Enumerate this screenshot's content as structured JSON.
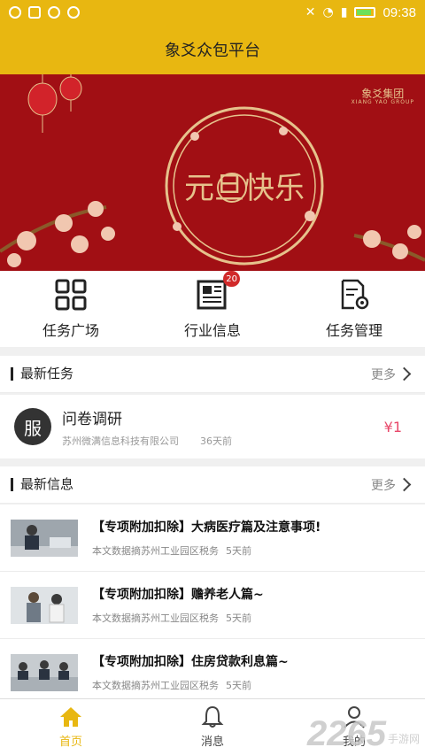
{
  "status": {
    "time": "09:38"
  },
  "header": {
    "title": "象爻众包平台"
  },
  "banner": {
    "text": "元旦快乐",
    "brand": "象爻集团",
    "brand_sub": "XIANG YAO GROUP"
  },
  "quick": [
    {
      "label": "任务广场",
      "icon": "grid-icon"
    },
    {
      "label": "行业信息",
      "icon": "newspaper-icon",
      "badge": "20"
    },
    {
      "label": "任务管理",
      "icon": "document-gear-icon"
    }
  ],
  "tasks": {
    "title": "最新任务",
    "more": "更多",
    "items": [
      {
        "avatar": "服",
        "title": "问卷调研",
        "company": "苏州微满信息科技有限公司",
        "time": "36天前",
        "price": "¥1"
      }
    ]
  },
  "news": {
    "title": "最新信息",
    "more": "更多",
    "items": [
      {
        "title": "【专项附加扣除】大病医疗篇及注意事项!",
        "source": "本文数据摘苏州工业园区税务",
        "time": "5天前"
      },
      {
        "title": "【专项附加扣除】赡养老人篇~",
        "source": "本文数据摘苏州工业园区税务",
        "time": "5天前"
      },
      {
        "title": "【专项附加扣除】住房贷款利息篇~",
        "source": "本文数据摘苏州工业园区税务",
        "time": "5天前"
      }
    ]
  },
  "tabbar": [
    {
      "label": "首页",
      "icon": "home-icon",
      "active": true
    },
    {
      "label": "消息",
      "icon": "bell-icon",
      "active": false
    },
    {
      "label": "我的",
      "icon": "user-icon",
      "active": false
    }
  ],
  "watermark": {
    "big": "2265",
    "small": "手游网"
  },
  "colors": {
    "accent": "#e8b711",
    "banner_red": "#a10f14",
    "price": "#e8486a",
    "badge": "#d12a2a"
  }
}
